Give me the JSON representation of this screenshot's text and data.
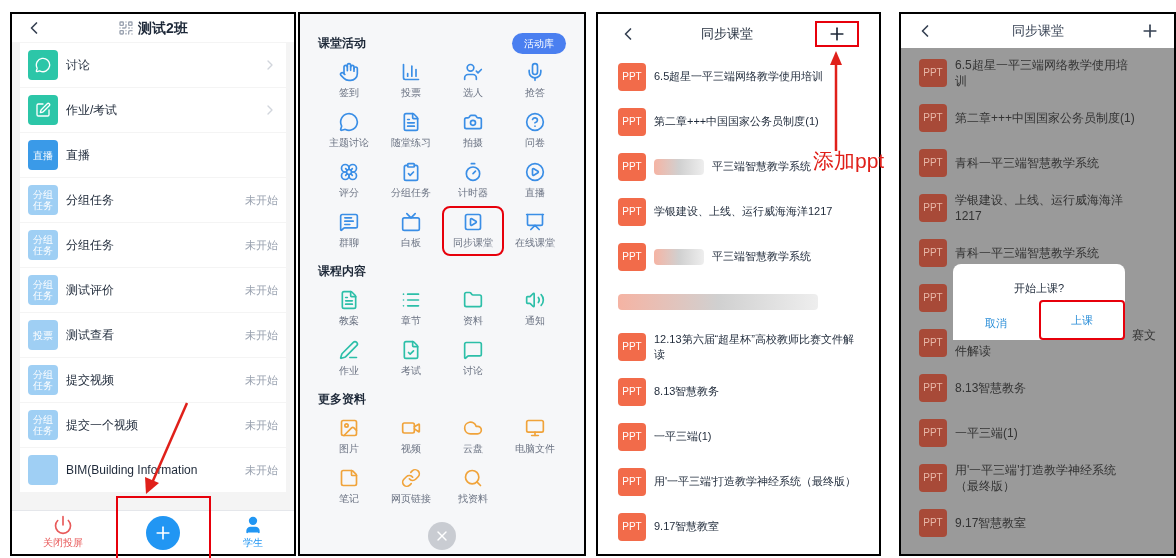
{
  "class_screen": {
    "title": "测试2班",
    "items": [
      {
        "kind": "chat",
        "label": "讨论",
        "chevron": true
      },
      {
        "kind": "edit",
        "label": "作业/考试",
        "chevron": true
      },
      {
        "kind": "badge",
        "badge": "直播",
        "color": "#3a9ae8",
        "label": "直播"
      },
      {
        "kind": "badge",
        "badge": "分组任务",
        "color": "#9fcff4",
        "label": "分组任务",
        "status": "未开始"
      },
      {
        "kind": "badge",
        "badge": "分组任务",
        "color": "#9fcff4",
        "label": "分组任务",
        "status": "未开始"
      },
      {
        "kind": "badge",
        "badge": "分组任务",
        "color": "#9fcff4",
        "label": "测试评价",
        "status": "未开始"
      },
      {
        "kind": "badge",
        "badge": "投票",
        "color": "#9fcff4",
        "label": "测试查看",
        "status": "未开始"
      },
      {
        "kind": "badge",
        "badge": "分组任务",
        "color": "#9fcff4",
        "label": "提交视频",
        "status": "未开始"
      },
      {
        "kind": "badge",
        "badge": "分组任务",
        "color": "#9fcff4",
        "label": "提交一个视频",
        "status": "未开始"
      },
      {
        "kind": "badge",
        "color": "#9fcff4",
        "label": "BIM(Building Information",
        "status": "未开始"
      }
    ],
    "nav": [
      {
        "kind": "screen",
        "label": "关闭投屏"
      },
      {
        "kind": "add",
        "highlighted": true
      },
      {
        "kind": "students",
        "label": "学生"
      }
    ]
  },
  "activity_screen": {
    "library_button": "活动库",
    "sections": [
      {
        "title": "课堂活动",
        "items": [
          {
            "label": "签到",
            "highlighted": false
          },
          {
            "label": "投票",
            "highlighted": false
          },
          {
            "label": "选人",
            "highlighted": false
          },
          {
            "label": "抢答",
            "highlighted": false
          },
          {
            "label": "主题讨论",
            "highlighted": false
          },
          {
            "label": "随堂练习",
            "highlighted": false
          },
          {
            "label": "拍摄",
            "highlighted": false
          },
          {
            "label": "问卷",
            "highlighted": false
          },
          {
            "label": "评分",
            "highlighted": false
          },
          {
            "label": "分组任务",
            "highlighted": false
          },
          {
            "label": "计时器",
            "highlighted": false
          },
          {
            "label": "直播",
            "highlighted": false
          },
          {
            "label": "群聊",
            "highlighted": false
          },
          {
            "label": "白板",
            "highlighted": false
          },
          {
            "label": "同步课堂",
            "highlighted": true
          },
          {
            "label": "在线课堂",
            "highlighted": false
          }
        ]
      },
      {
        "title": "课程内容",
        "items": [
          {
            "label": "教案",
            "highlighted": false
          },
          {
            "label": "章节",
            "highlighted": false
          },
          {
            "label": "资料",
            "highlighted": false
          },
          {
            "label": "通知",
            "highlighted": false
          },
          {
            "label": "作业",
            "highlighted": false
          },
          {
            "label": "考试",
            "highlighted": false
          },
          {
            "label": "讨论",
            "highlighted": false
          }
        ]
      },
      {
        "title": "更多资料",
        "items": [
          {
            "label": "图片",
            "highlighted": false
          },
          {
            "label": "视频",
            "highlighted": false
          },
          {
            "label": "云盘",
            "highlighted": false
          },
          {
            "label": "电脑文件",
            "highlighted": false
          },
          {
            "label": "笔记",
            "highlighted": false
          },
          {
            "label": "网页链接",
            "highlighted": false
          },
          {
            "label": "找资料",
            "highlighted": false
          }
        ]
      }
    ]
  },
  "sync_screen": {
    "title": "同步课堂",
    "add_highlighted": true,
    "annotation": "添加ppt",
    "rows": [
      {
        "badge": "PPT",
        "text": "6.5超星一平三端网络教学使用培训",
        "blurred": false
      },
      {
        "badge": "PPT",
        "text": "第二章+++中国国家公务员制度(1)",
        "blurred": false
      },
      {
        "badge": "PPT",
        "text": "平三端智慧教学系统",
        "blurred": true
      },
      {
        "badge": "PPT",
        "text": "学银建设、上线、运行威海海洋1217",
        "blurred": false
      },
      {
        "badge": "PPT",
        "text": "平三端智慧教学系统",
        "blurred": true
      },
      {
        "blurred": true
      },
      {
        "badge": "PPT",
        "text": "12.13第六届“超星杯”高校教师比赛文件解读",
        "blurred": false
      },
      {
        "badge": "PPT",
        "text": "8.13智慧教务",
        "blurred": false
      },
      {
        "badge": "PPT",
        "text": "一平三端(1)",
        "blurred": false
      },
      {
        "badge": "PPT",
        "text": "用'一平三端'打造教学神经系统（最终版）",
        "blurred": false
      },
      {
        "badge": "PPT",
        "text": "9.17智慧教室",
        "blurred": false
      }
    ]
  },
  "start_screen": {
    "title": "同步课堂",
    "rows": [
      {
        "kind": "full",
        "badge": "PPT",
        "text": "6.5超星一平三端网络教学使用培训"
      },
      {
        "kind": "full",
        "badge": "PPT",
        "text": "第二章+++中国国家公务员制度(1)"
      },
      {
        "kind": "full",
        "badge": "PPT",
        "text": "青科一平三端智慧教学系统"
      },
      {
        "kind": "full",
        "badge": "PPT",
        "text": "学银建设、上线、运行威海海洋1217"
      },
      {
        "kind": "full",
        "badge": "PPT",
        "text": "青科一平三端智慧教学系统"
      },
      {
        "kind": "covered",
        "badge": "PPT"
      },
      {
        "kind": "partial",
        "badge": "PPT",
        "tail": "赛文",
        "line_2": "件解读"
      },
      {
        "kind": "full",
        "badge": "PPT",
        "text": "8.13智慧教务"
      },
      {
        "kind": "full",
        "badge": "PPT",
        "text": "一平三端(1)"
      },
      {
        "kind": "full",
        "badge": "PPT",
        "text": "用'一平三端'打造教学神经系统（最终版）"
      },
      {
        "kind": "full",
        "badge": "PPT",
        "text": "9.17智慧教室"
      }
    ],
    "dialog": {
      "message": "开始上课?",
      "buttons": [
        {
          "label": "取消",
          "highlighted": false
        },
        {
          "label": "上课",
          "highlighted": true
        }
      ]
    }
  }
}
